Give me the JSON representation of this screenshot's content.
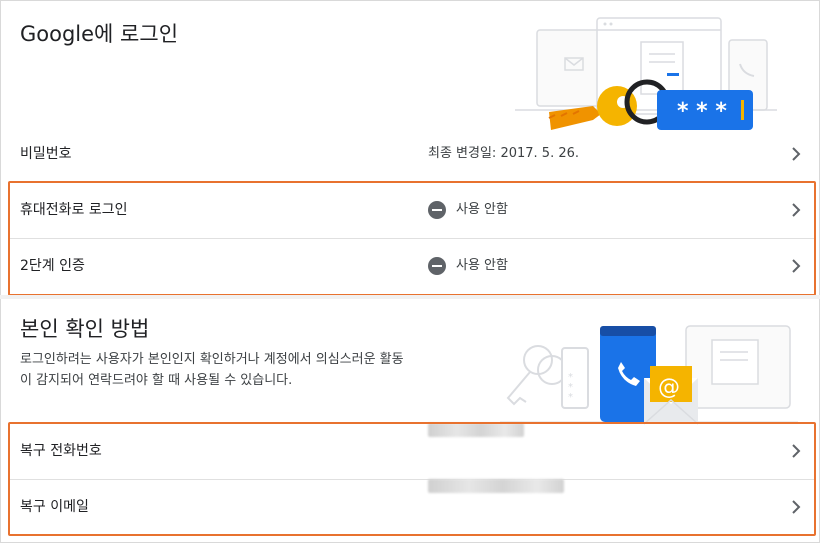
{
  "signin": {
    "title": "Google에 로그인",
    "password": {
      "label": "비밀번호",
      "value": "최종 변경일: 2017. 5. 26."
    },
    "phone_signin": {
      "label": "휴대전화로 로그인",
      "value": "사용 안함"
    },
    "two_step": {
      "label": "2단계 인증",
      "value": "사용 안함"
    }
  },
  "verify": {
    "title": "본인 확인 방법",
    "desc_line1": "로그인하려는 사용자가 본인인지 확인하거나 계정에서 의심스러운 활동",
    "desc_line2": "이 감지되어 연락드려야 할 때 사용될 수 있습니다.",
    "recovery_phone": {
      "label": "복구 전화번호"
    },
    "recovery_email": {
      "label": "복구 이메일"
    }
  },
  "colors": {
    "highlight": "#e8722f",
    "google_blue": "#1a73e8",
    "key_yellow": "#f5b400"
  },
  "icons": {
    "row_chevron": "chevron-right-icon",
    "status_off": "minus-circle-icon"
  }
}
